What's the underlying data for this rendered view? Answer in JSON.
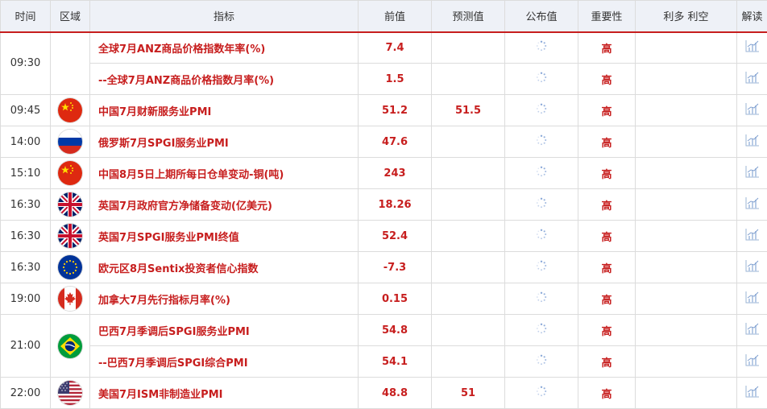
{
  "headers": {
    "time": "时间",
    "region": "区域",
    "indicator": "指标",
    "previous": "前值",
    "forecast": "预测值",
    "actual": "公布值",
    "importance": "重要性",
    "impact": "利多 利空",
    "analysis": "解读"
  },
  "rows": [
    {
      "time": "09:30",
      "flag": "",
      "indicator": "全球7月ANZ商品价格指数年率(%)",
      "previous": "7.4",
      "forecast": "",
      "importance": "高"
    },
    {
      "time": "",
      "flag": "",
      "indicator": "--全球7月ANZ商品价格指数月率(%)",
      "previous": "1.5",
      "forecast": "",
      "importance": "高"
    },
    {
      "time": "09:45",
      "flag": "china-flag-icon",
      "indicator": "中国7月财新服务业PMI",
      "previous": "51.2",
      "forecast": "51.5",
      "importance": "高"
    },
    {
      "time": "14:00",
      "flag": "russia-flag-icon",
      "indicator": "俄罗斯7月SPGI服务业PMI",
      "previous": "47.6",
      "forecast": "",
      "importance": "高"
    },
    {
      "time": "15:10",
      "flag": "china-flag-icon",
      "indicator": "中国8月5日上期所每日仓单变动-铜(吨)",
      "previous": "243",
      "forecast": "",
      "importance": "高"
    },
    {
      "time": "16:30",
      "flag": "uk-flag-icon",
      "indicator": "英国7月政府官方净储备变动(亿美元)",
      "previous": "18.26",
      "forecast": "",
      "importance": "高"
    },
    {
      "time": "16:30",
      "flag": "uk-flag-icon",
      "indicator": "英国7月SPGI服务业PMI终值",
      "previous": "52.4",
      "forecast": "",
      "importance": "高"
    },
    {
      "time": "16:30",
      "flag": "eu-flag-icon",
      "indicator": "欧元区8月Sentix投资者信心指数",
      "previous": "-7.3",
      "forecast": "",
      "importance": "高"
    },
    {
      "time": "19:00",
      "flag": "canada-flag-icon",
      "indicator": "加拿大7月先行指标月率(%)",
      "previous": "0.15",
      "forecast": "",
      "importance": "高"
    },
    {
      "time": "21:00",
      "flag": "brazil-flag-icon",
      "indicator": "巴西7月季调后SPGI服务业PMI",
      "previous": "54.8",
      "forecast": "",
      "importance": "高"
    },
    {
      "time": "",
      "flag": "",
      "indicator": "--巴西7月季调后SPGI综合PMI",
      "previous": "54.1",
      "forecast": "",
      "importance": "高"
    },
    {
      "time": "22:00",
      "flag": "usa-flag-icon",
      "indicator": "美国7月ISM非制造业PMI",
      "previous": "48.8",
      "forecast": "51",
      "importance": "高"
    }
  ],
  "colors": {
    "accent": "#c71e1e",
    "header_bg": "#eef1f7",
    "border": "#dcdcdc"
  }
}
